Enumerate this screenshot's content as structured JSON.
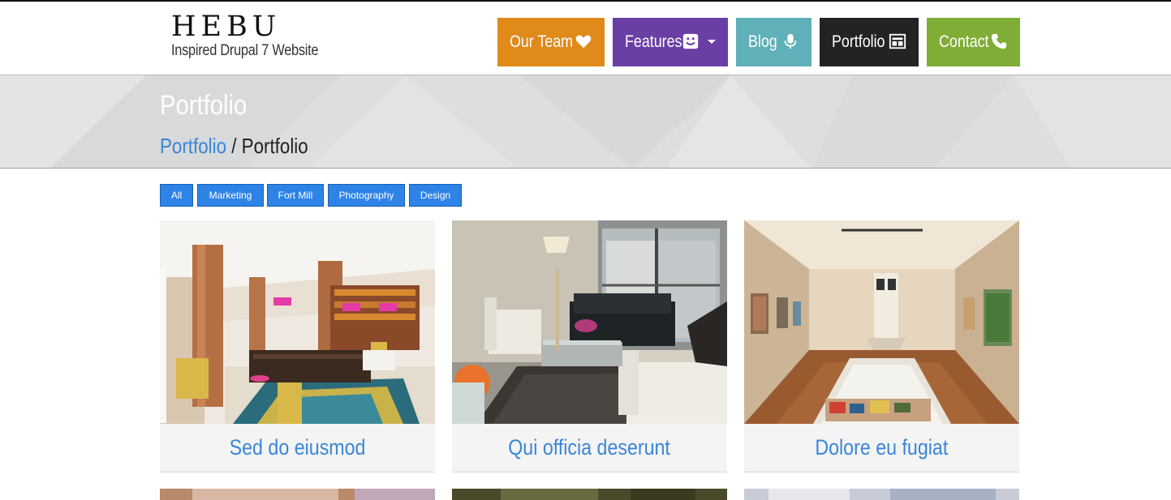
{
  "logo": {
    "title": "HEBU",
    "subtitle": "Inspired Drupal 7 Website"
  },
  "nav": {
    "items": [
      {
        "label": "Our Team",
        "icon": "heart-icon",
        "color": "#e08a1a"
      },
      {
        "label": "Features",
        "icon": "smiley-icon",
        "color": "#6a3fa4"
      },
      {
        "label": "Blog",
        "icon": "microphone-icon",
        "color": "#5fb0b8"
      },
      {
        "label": "Portfolio",
        "icon": "layout-icon",
        "color": "#232323"
      },
      {
        "label": "Contact",
        "icon": "phone-icon",
        "color": "#80ad36"
      }
    ]
  },
  "page": {
    "title": "Portfolio",
    "breadcrumb": {
      "link": "Portfolio",
      "separator": " / ",
      "current": "Portfolio"
    }
  },
  "filters": [
    "All",
    "Marketing",
    "Fort Mill",
    "Photography",
    "Design"
  ],
  "portfolio": {
    "items": [
      {
        "title": "Sed do eiusmod",
        "image": "hotel-lobby-photo"
      },
      {
        "title": "Qui officia deserunt",
        "image": "living-room-photo"
      },
      {
        "title": "Dolore eu fugiat",
        "image": "art-gallery-photo"
      }
    ]
  },
  "colors": {
    "link": "#3a86d8",
    "filter_button": "#2d83e6",
    "band": "#dcdedf"
  }
}
